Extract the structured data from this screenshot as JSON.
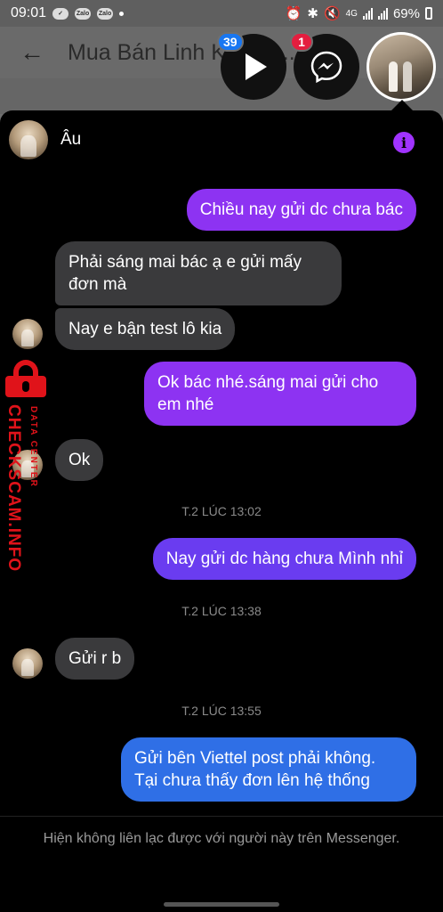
{
  "status_bar": {
    "time": "09:01",
    "mini_apps": [
      "Zalo",
      "Zalo"
    ],
    "network": "4G",
    "battery": "69%"
  },
  "background_page": {
    "title": "Mua Bán Linh K... Trà..."
  },
  "chat_heads": {
    "video_badge": "39",
    "messenger_badge": "1"
  },
  "chat": {
    "contact_name": "Âu",
    "messages": [
      {
        "side": "out",
        "text": "Chiều nay gửi dc chưa bác"
      },
      {
        "side": "in",
        "text": "Phải sáng mai bác ạ e gửi mấy đơn mà"
      },
      {
        "side": "in",
        "text": "Nay e bận test lô kia"
      },
      {
        "side": "out",
        "text": "Ok bác nhé.sáng mai gửi cho em nhé"
      },
      {
        "side": "in",
        "text": "Ok"
      },
      {
        "type": "timestamp",
        "text": "T.2 LÚC 13:02"
      },
      {
        "side": "out",
        "text": "Nay gửi dc hàng chưa Mình nhỉ"
      },
      {
        "type": "timestamp",
        "text": "T.2 LÚC 13:38"
      },
      {
        "side": "in",
        "text": "Gửi r b"
      },
      {
        "type": "timestamp",
        "text": "T.2 LÚC 13:55"
      },
      {
        "side": "out",
        "text": "Gửi bên Viettel post phải không. Tại chưa thấy đơn lên hệ thống"
      }
    ],
    "footer_note": "Hiện không liên lạc được với người này trên Messenger."
  },
  "watermark": {
    "small_text": "DATA CENTER",
    "big_text": "CHECKSCAM.INFO"
  },
  "colors": {
    "incoming_bubble": "#3a3a3c",
    "outgoing_purple": "#8d33f2",
    "outgoing_violet": "#6a3cf0",
    "outgoing_blue": "#2f6fe6",
    "watermark_red": "#e0131a"
  }
}
